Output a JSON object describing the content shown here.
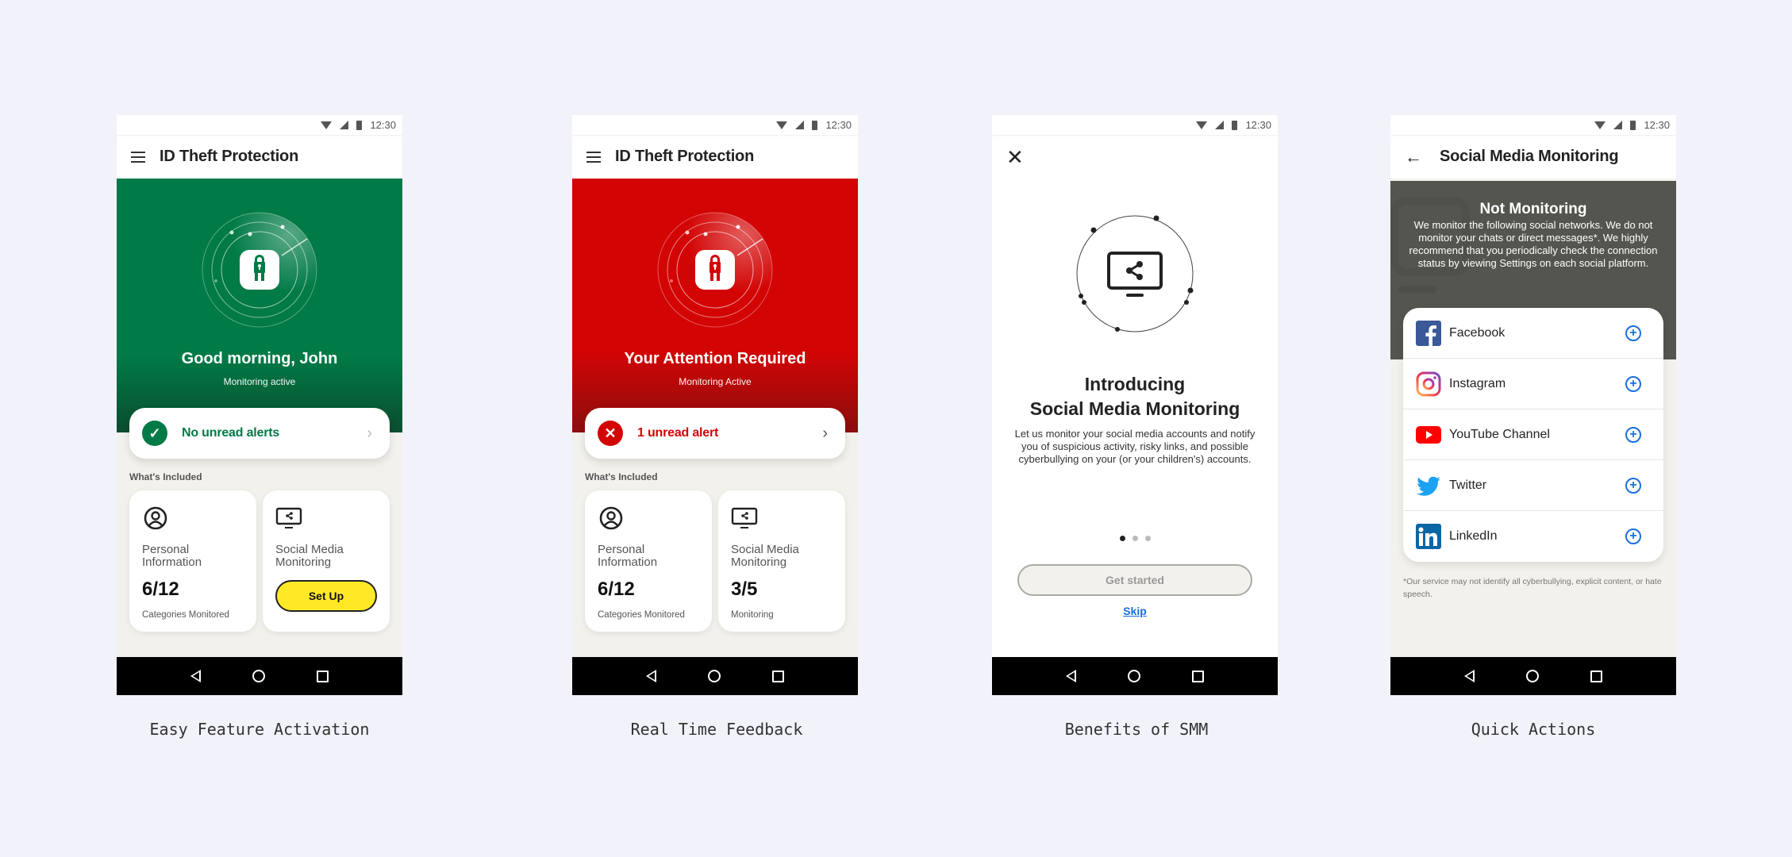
{
  "status_bar": {
    "time": "12:30"
  },
  "colors": {
    "page_bg": "#f1f2fa",
    "green": "#007a46",
    "red": "#d30404",
    "yellow": "#ffe926",
    "link_blue": "#1a6fe0",
    "dark_gray": "#55554f"
  },
  "screens": [
    {
      "caption": "Easy Feature Activation",
      "app_title": "ID Theft Protection",
      "hero_title": "Good morning, John",
      "hero_subtitle": "Monitoring active",
      "alert_text": "No unread alerts",
      "alert_status": "ok",
      "section_label": "What's Included",
      "cards": [
        {
          "name": "Personal Information",
          "value": "6/12",
          "caption": "Categories Monitored",
          "icon": "person-circle-icon"
        },
        {
          "name": "Social Media Monitoring",
          "button_label": "Set Up",
          "icon": "monitor-share-icon"
        }
      ]
    },
    {
      "caption": "Real Time Feedback",
      "app_title": "ID Theft Protection",
      "hero_title": "Your Attention Required",
      "hero_subtitle": "Monitoring Active",
      "alert_text": "1 unread alert",
      "alert_status": "error",
      "section_label": "What's Included",
      "cards": [
        {
          "name": "Personal Information",
          "value": "6/12",
          "caption": "Categories Monitored",
          "icon": "person-circle-icon"
        },
        {
          "name": "Social Media Monitoring",
          "value": "3/5",
          "caption": "Monitoring",
          "icon": "monitor-share-icon"
        }
      ]
    },
    {
      "caption": "Benefits of SMM",
      "title_line1": "Introducing",
      "title_line2": "Social Media Monitoring",
      "body": "Let us monitor your social media accounts and notify you of suspicious activity, risky links, and possible cyberbullying on your (or your children's) accounts.",
      "pager": {
        "count": 3,
        "active": 1
      },
      "primary_button": "Get started",
      "skip_link": "Skip"
    },
    {
      "caption": "Quick Actions",
      "app_title": "Social Media Monitoring",
      "status_title": "Not Monitoring",
      "status_body": "We monitor the following social networks. We do not monitor your chats or direct messages*. We highly recommend that you periodically check the connection status by viewing Settings on each social platform.",
      "networks": [
        {
          "name": "Facebook",
          "icon": "facebook-icon"
        },
        {
          "name": "Instagram",
          "icon": "instagram-icon"
        },
        {
          "name": "YouTube Channel",
          "icon": "youtube-icon"
        },
        {
          "name": "Twitter",
          "icon": "twitter-icon"
        },
        {
          "name": "LinkedIn",
          "icon": "linkedin-icon"
        }
      ],
      "disclaimer": "*Our service may not identify all cyberbullying, explicit content, or hate speech."
    }
  ]
}
